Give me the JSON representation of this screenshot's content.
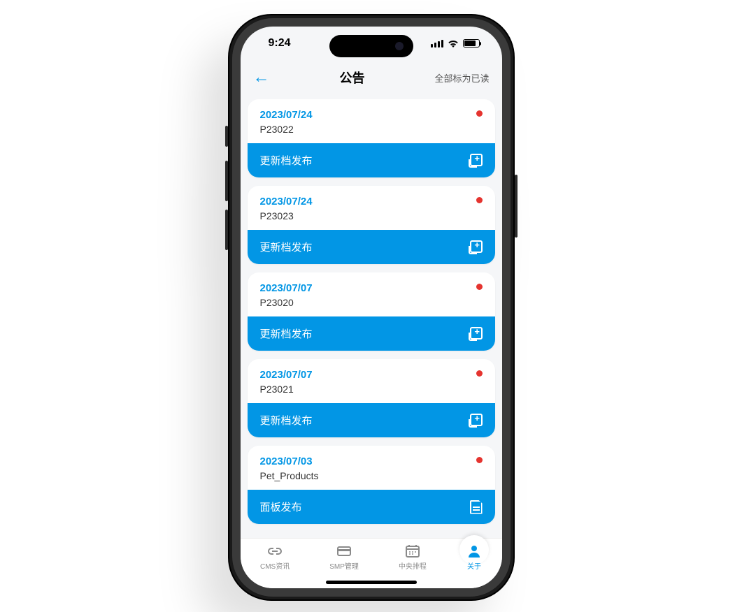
{
  "status": {
    "time": "9:24"
  },
  "header": {
    "title": "公告",
    "mark_all": "全部标为已读"
  },
  "items": [
    {
      "date": "2023/07/24",
      "code": "P23022",
      "action": "更新档发布",
      "icon": "copy"
    },
    {
      "date": "2023/07/24",
      "code": "P23023",
      "action": "更新档发布",
      "icon": "copy"
    },
    {
      "date": "2023/07/07",
      "code": "P23020",
      "action": "更新档发布",
      "icon": "copy"
    },
    {
      "date": "2023/07/07",
      "code": "P23021",
      "action": "更新档发布",
      "icon": "copy"
    },
    {
      "date": "2023/07/03",
      "code": "Pet_Products",
      "action": "面板发布",
      "icon": "file"
    }
  ],
  "tabs": [
    {
      "label": "CMS资讯",
      "icon": "link"
    },
    {
      "label": "SMP管理",
      "icon": "card"
    },
    {
      "label": "中央排程",
      "icon": "calendar"
    },
    {
      "label": "关于",
      "icon": "person",
      "active": true
    }
  ]
}
